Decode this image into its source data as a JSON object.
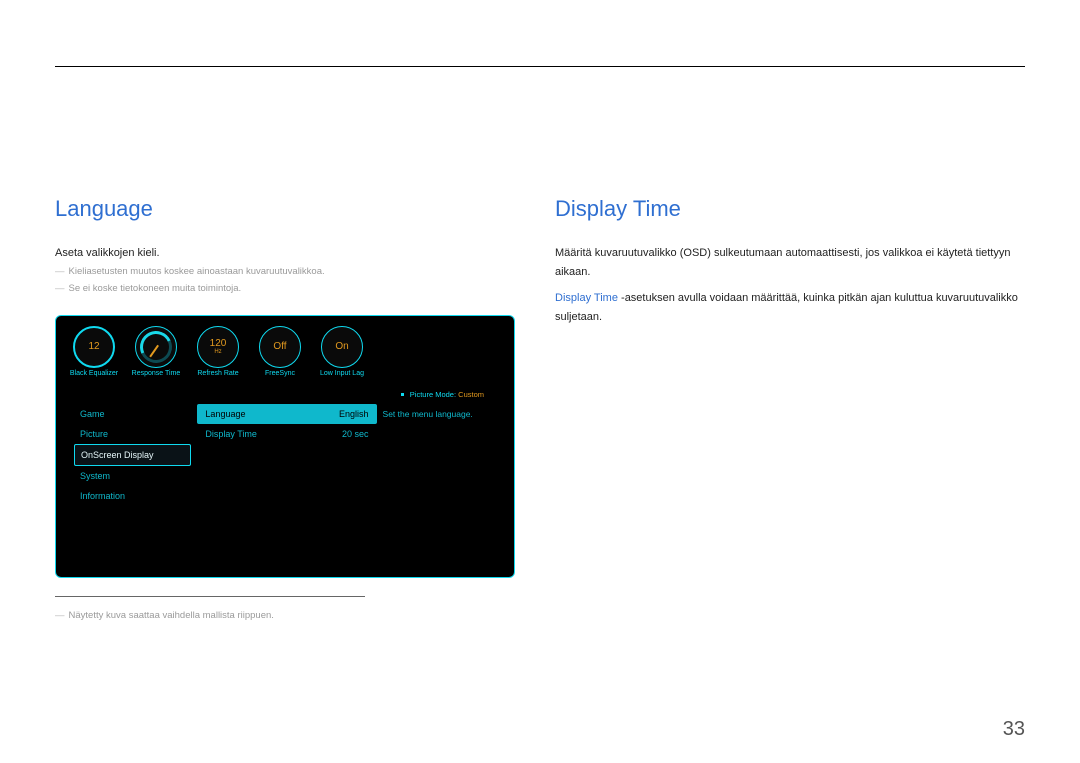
{
  "page_number": "33",
  "left": {
    "heading": "Language",
    "intro": "Aseta valikkojen kieli.",
    "note1": "Kieliasetusten muutos koskee ainoastaan kuvaruutuvalikkoa.",
    "note2": "Se ei koske tietokoneen muita toimintoja.",
    "footnote": "Näytetty kuva saattaa vaihdella mallista riippuen."
  },
  "right": {
    "heading": "Display Time",
    "para1": "Määritä kuvaruutuvalikko (OSD) sulkeutumaan automaattisesti, jos valikkoa ei käytetä tiettyyn aikaan.",
    "para2_prefix": "Display Time",
    "para2_rest": " -asetuksen avulla voidaan määrittää, kuinka pitkän ajan kuluttua kuvaruutuvalikko suljetaan."
  },
  "osd": {
    "badges": {
      "black_eq": {
        "value": "12",
        "label": "Black Equalizer"
      },
      "response": {
        "label": "Response Time"
      },
      "refresh": {
        "value": "120",
        "unit": "Hz",
        "label": "Refresh Rate"
      },
      "freesync": {
        "value": "Off",
        "label": "FreeSync"
      },
      "lowlag": {
        "value": "On",
        "label": "Low Input Lag"
      }
    },
    "picture_mode_label": "Picture Mode:",
    "picture_mode_value": "Custom",
    "nav": [
      "Game",
      "Picture",
      "OnScreen Display",
      "System",
      "Information"
    ],
    "nav_active_index": 2,
    "settings": [
      {
        "k": "Language",
        "v": "English",
        "selected": true
      },
      {
        "k": "Display Time",
        "v": "20 sec",
        "selected": false
      }
    ],
    "help": "Set the menu language."
  }
}
